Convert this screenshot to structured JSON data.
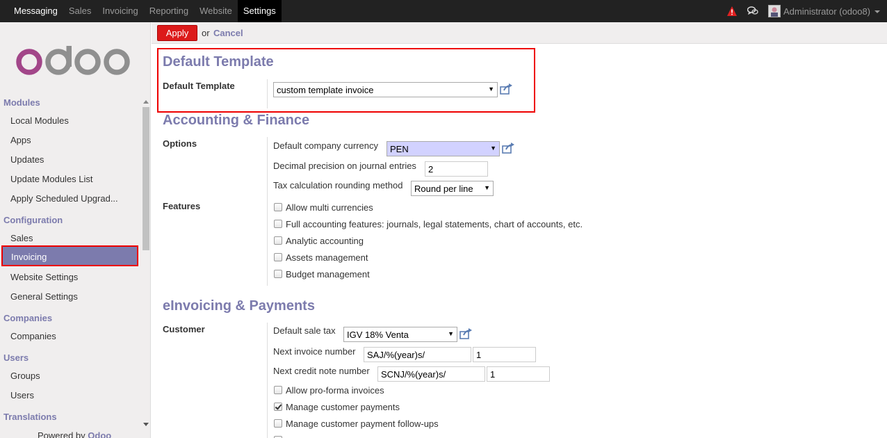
{
  "topnav": {
    "items": [
      "Messaging",
      "Sales",
      "Invoicing",
      "Reporting",
      "Website",
      "Settings"
    ],
    "user": "Administrator (odoo8)"
  },
  "sidebar": {
    "sections": [
      {
        "title": "Modules",
        "items": [
          "Local Modules",
          "Apps",
          "Updates",
          "Update Modules List",
          "Apply Scheduled Upgrad..."
        ]
      },
      {
        "title": "Configuration",
        "items": [
          "Sales",
          "Invoicing",
          "Website Settings",
          "General Settings"
        ]
      },
      {
        "title": "Companies",
        "items": [
          "Companies"
        ]
      },
      {
        "title": "Users",
        "items": [
          "Groups",
          "Users"
        ]
      },
      {
        "title": "Translations",
        "items": []
      }
    ],
    "powered_prefix": "Powered by",
    "powered_brand": "Odoo"
  },
  "actions": {
    "apply": "Apply",
    "or": "or",
    "cancel": "Cancel"
  },
  "default_template": {
    "heading": "Default Template",
    "label": "Default Template",
    "value": "custom template invoice"
  },
  "accounting": {
    "heading": "Accounting & Finance",
    "options_label": "Options",
    "currency_label": "Default company currency",
    "currency_value": "PEN",
    "precision_label": "Decimal precision on journal entries",
    "precision_value": "2",
    "rounding_label": "Tax calculation rounding method",
    "rounding_value": "Round per line",
    "features_label": "Features",
    "features": [
      {
        "label": "Allow multi currencies",
        "checked": false
      },
      {
        "label": "Full accounting features: journals, legal statements, chart of accounts, etc.",
        "checked": false
      },
      {
        "label": "Analytic accounting",
        "checked": false
      },
      {
        "label": "Assets management",
        "checked": false
      },
      {
        "label": "Budget management",
        "checked": false
      }
    ]
  },
  "einvoicing": {
    "heading": "eInvoicing & Payments",
    "customer_label": "Customer",
    "sale_tax_label": "Default sale tax",
    "sale_tax_value": "IGV 18% Venta",
    "invoice_number_label": "Next invoice number",
    "invoice_prefix": "SAJ/%(year)s/",
    "invoice_next": "1",
    "credit_note_label": "Next credit note number",
    "credit_prefix": "SCNJ/%(year)s/",
    "credit_next": "1",
    "options": [
      {
        "label": "Allow pro-forma invoices",
        "checked": false
      },
      {
        "label": "Manage customer payments",
        "checked": true
      },
      {
        "label": "Manage customer payment follow-ups",
        "checked": false
      }
    ]
  },
  "colors": {
    "accent": "#7c7bad",
    "apply": "#dc1a1a",
    "highlight": "#ee0000",
    "topbar": "#222222"
  }
}
